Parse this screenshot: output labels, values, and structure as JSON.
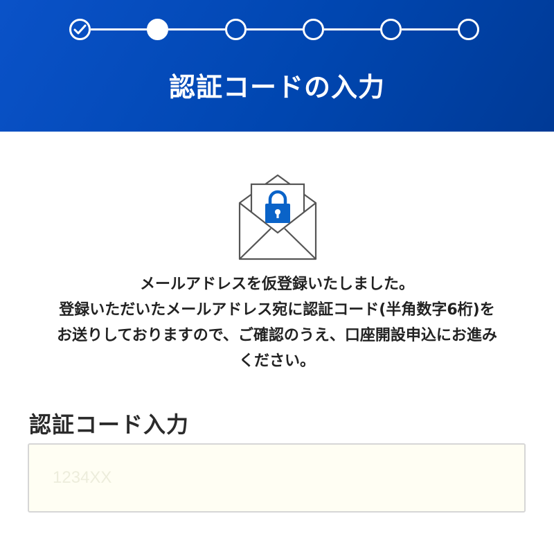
{
  "header": {
    "title": "認証コードの入力",
    "background_color": "#0047b3",
    "stepper": {
      "total_steps": 6,
      "current_step": 2,
      "steps": [
        {
          "state": "done",
          "icon": "check-icon"
        },
        {
          "state": "current"
        },
        {
          "state": "todo"
        },
        {
          "state": "todo"
        },
        {
          "state": "todo"
        },
        {
          "state": "todo"
        }
      ]
    }
  },
  "main": {
    "illustration_icon": "envelope-lock-icon",
    "lock_color": "#0a63c8",
    "message_lines": [
      "メールアドレスを仮登録いたしました。",
      "登録いただいたメールアドレス宛に認証コード(半角数字6桁)を",
      "お送りしておりますので、ご確認のうえ、口座開設申込にお進み",
      "ください。"
    ],
    "code_section": {
      "label": "認証コード入力",
      "input_value": "",
      "input_placeholder": "1234XX"
    }
  }
}
